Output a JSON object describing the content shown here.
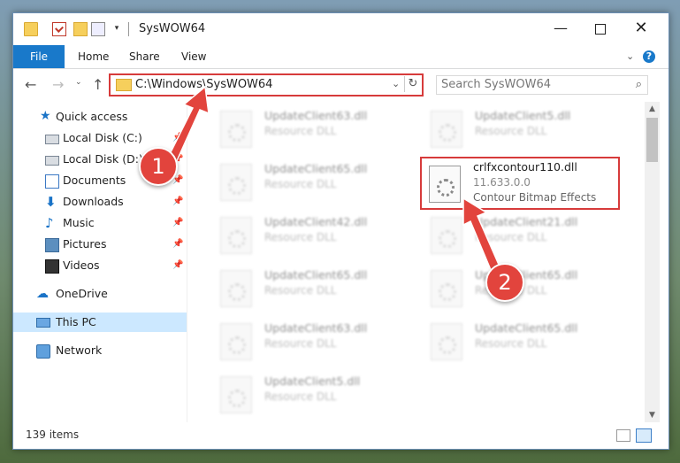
{
  "window": {
    "title": "SysWOW64",
    "controls": {
      "minimize": "—",
      "maximize": "",
      "close": "✕"
    }
  },
  "quick_access_toolbar": {
    "dropdown": "▾"
  },
  "ribbon": {
    "tabs": [
      "File",
      "Home",
      "Share",
      "View"
    ],
    "expand": "⌄",
    "help": "?"
  },
  "navigation": {
    "back": "←",
    "forward": "→",
    "recent": "⌄",
    "up": "↑",
    "address": "C:\\Windows\\SysWOW64",
    "address_dropdown": "⌄",
    "refresh": "↻",
    "search_placeholder": "Search SysWOW64",
    "search_icon": "⌕"
  },
  "nav_pane": {
    "items": [
      {
        "label": "Quick access",
        "icon": "star-icon",
        "pinned": false
      },
      {
        "label": "Local Disk (C:)",
        "icon": "drive-icon",
        "pinned": true
      },
      {
        "label": "Local Disk (D:)",
        "icon": "drive-icon",
        "pinned": true
      },
      {
        "label": "Documents",
        "icon": "documents-icon",
        "pinned": true
      },
      {
        "label": "Downloads",
        "icon": "downloads-icon",
        "pinned": true
      },
      {
        "label": "Music",
        "icon": "music-icon",
        "pinned": true
      },
      {
        "label": "Pictures",
        "icon": "pictures-icon",
        "pinned": true
      },
      {
        "label": "Videos",
        "icon": "videos-icon",
        "pinned": true
      },
      {
        "label": "OneDrive",
        "icon": "cloud-icon",
        "pinned": false
      },
      {
        "label": "This PC",
        "icon": "pc-icon",
        "pinned": false,
        "selected": true
      },
      {
        "label": "Network",
        "icon": "network-icon",
        "pinned": false
      }
    ],
    "pin_glyph": "📌"
  },
  "files": {
    "left_column": [
      {
        "name": "UpdateClient63.dll",
        "desc": "Resource DLL"
      },
      {
        "name": "UpdateClient65.dll",
        "desc": "Resource DLL"
      },
      {
        "name": "UpdateClient42.dll",
        "desc": "Resource DLL"
      },
      {
        "name": "UpdateClient65.dll",
        "desc": "Resource DLL"
      },
      {
        "name": "UpdateClient63.dll",
        "desc": "Resource DLL"
      },
      {
        "name": "UpdateClient5.dll",
        "desc": "Resource DLL"
      }
    ],
    "right_column": [
      {
        "name": "UpdateClient5.dll",
        "desc": "Resource DLL"
      },
      {
        "name": "crlfxcontour110.dll",
        "version": "11.633.0.0",
        "desc": "Contour Bitmap Effects",
        "highlighted": true
      },
      {
        "name": "UpdateClient21.dll",
        "desc": "Resource DLL"
      },
      {
        "name": "UpdateClient65.dll",
        "desc": "Resource DLL"
      },
      {
        "name": "UpdateClient65.dll",
        "desc": "Resource DLL"
      }
    ]
  },
  "status_bar": {
    "item_count": "139 items"
  },
  "annotations": {
    "step1": "1",
    "step2": "2",
    "color": "#e2443d"
  },
  "colors": {
    "accent": "#1979ca",
    "highlight_border": "#d73b3b",
    "selected_bg": "#cce8ff"
  }
}
